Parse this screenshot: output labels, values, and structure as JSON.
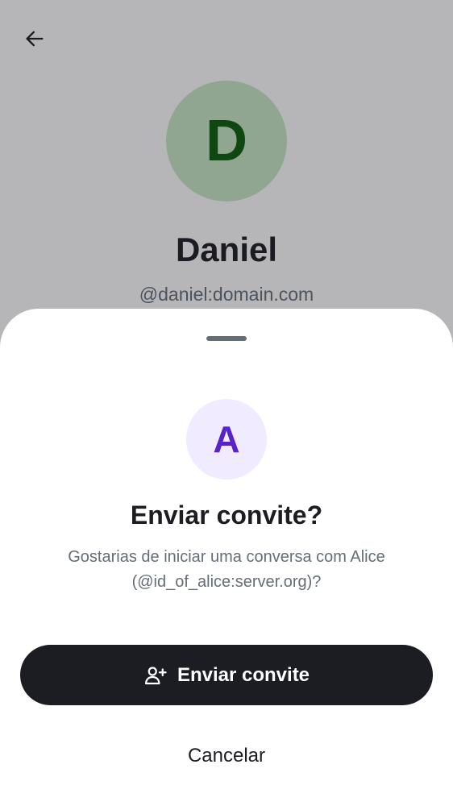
{
  "profile": {
    "back_icon": "arrow-left-icon",
    "avatar_initial": "D",
    "avatar_bg": "#c7e8c6",
    "avatar_fg": "#0a5c0a",
    "name": "Daniel",
    "handle": "@daniel:domain.com"
  },
  "invite_sheet": {
    "avatar_initial": "A",
    "avatar_bg": "#f0ebff",
    "avatar_fg": "#5a23c8",
    "title": "Enviar convite?",
    "message": "Gostarias de iniciar uma conversa com Alice (@id_of_alice:server.org)?",
    "primary_button": {
      "label": "Enviar convite",
      "icon": "user-add-icon",
      "color": "#1b1d22"
    },
    "secondary_button": {
      "label": "Cancelar"
    }
  }
}
